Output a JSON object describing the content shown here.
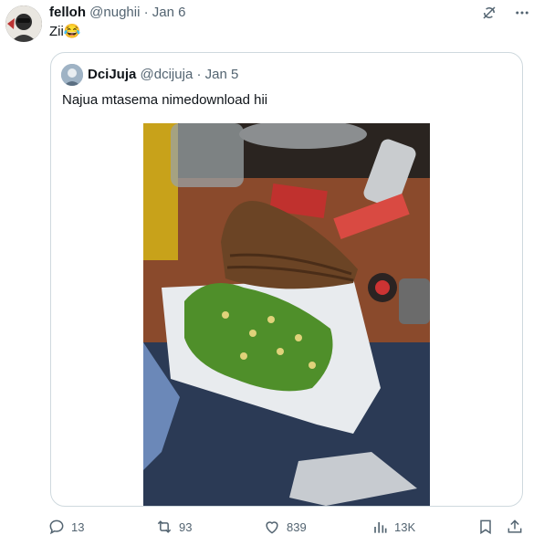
{
  "tweet": {
    "author_name": "felloh",
    "author_handle": "@nughii",
    "separator": "·",
    "date": "Jan 6",
    "text": "Zii😂"
  },
  "top_icons": [
    "grok-icon",
    "more-options-icon"
  ],
  "quoted_tweet": {
    "author_name": "DciJuja",
    "author_handle": "@dcijuja",
    "separator": "·",
    "date": "Jan 5",
    "text": "Najua mtasema nimedownload hii",
    "media": {
      "description_icon": "food-photo"
    }
  },
  "actions": {
    "replies": "13",
    "retweets": "93",
    "likes": "839",
    "views": "13K"
  },
  "colors": {
    "text": "#0f1419",
    "muted": "#536471",
    "border": "#cfd9de"
  }
}
